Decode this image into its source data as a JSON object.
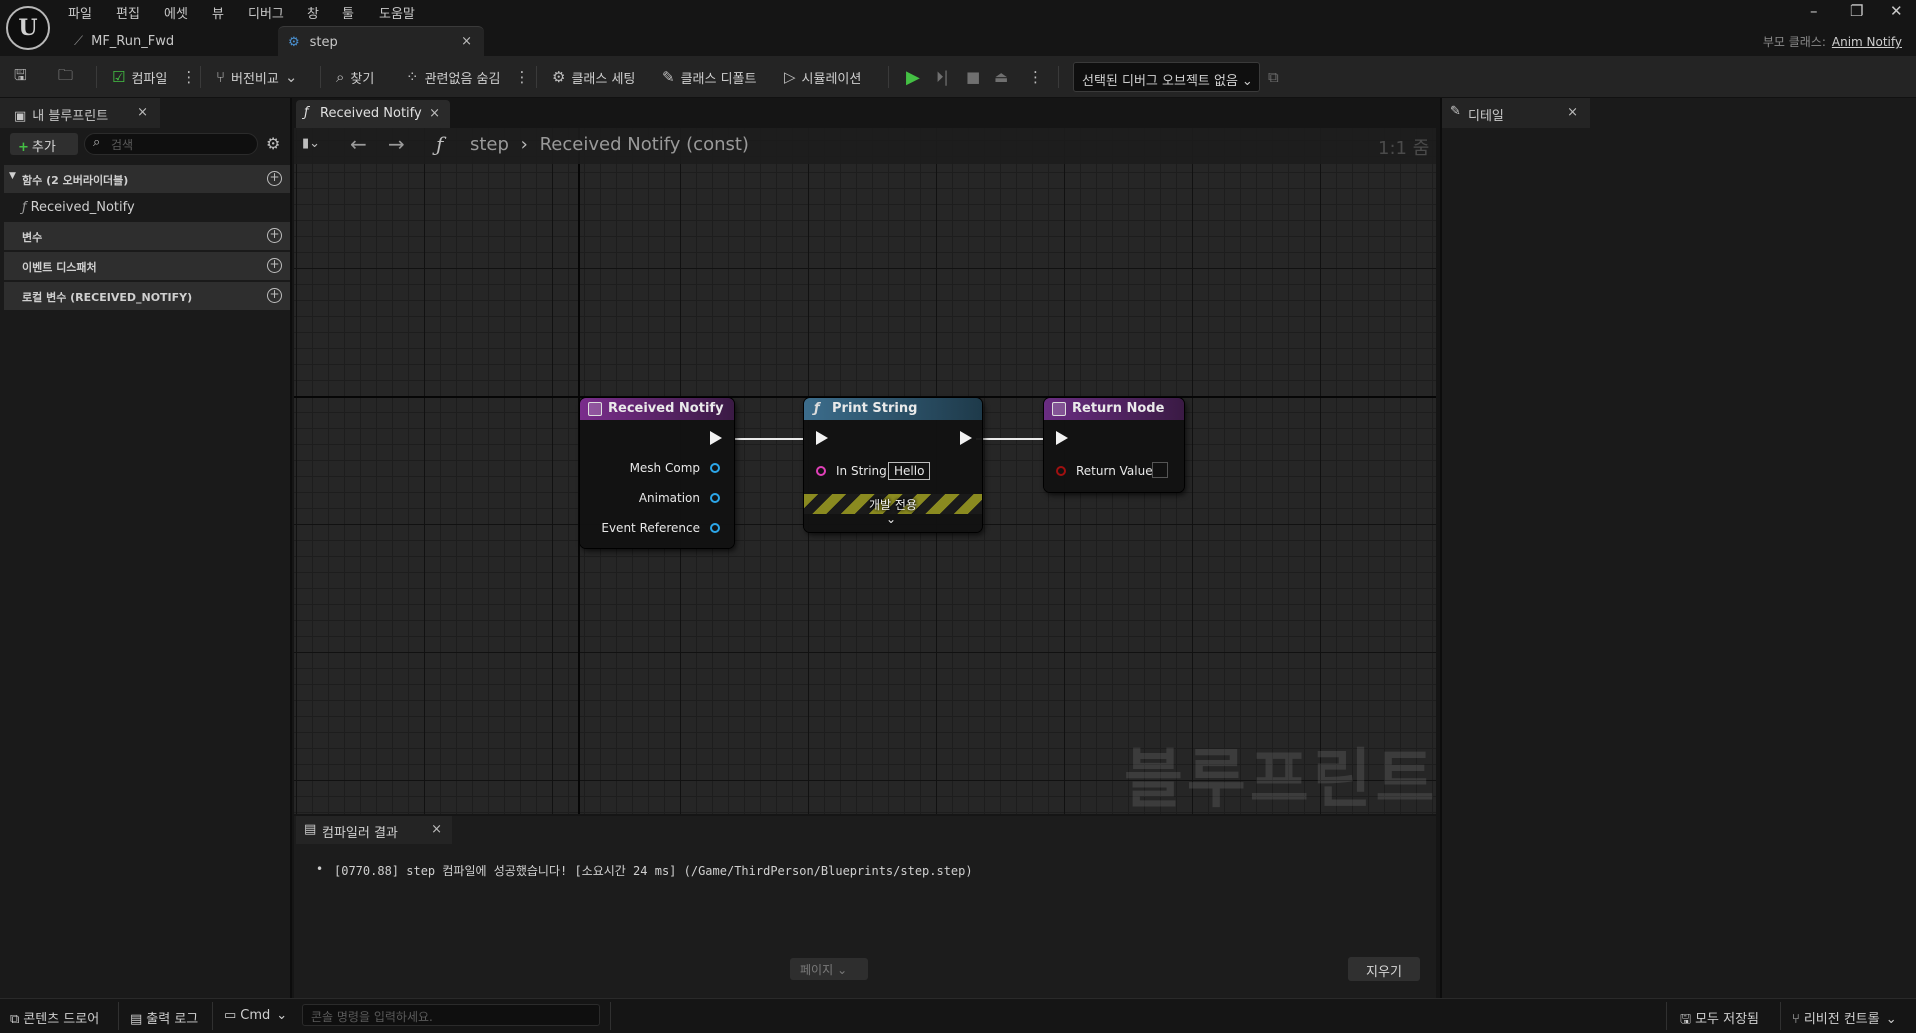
{
  "menu": [
    "파일",
    "편집",
    "에셋",
    "뷰",
    "디버그",
    "창",
    "툴",
    "도움말"
  ],
  "tabs": {
    "asset": "MF_Run_Fwd",
    "step": "step"
  },
  "window": {
    "minimize": "–",
    "restore": "❐",
    "close": "✕"
  },
  "parent_class": {
    "label": "부모 클래스:",
    "value": "Anim Notify"
  },
  "toolbar": {
    "compile": "컴파일",
    "diff": "버전비교",
    "find": "찾기",
    "hide_unrelated": "관련없음 숨김",
    "class_settings": "클래스 세팅",
    "class_defaults": "클래스 디폴트",
    "simulation": "시뮬레이션",
    "debug_object": "선택된 디버그 오브젝트 없음"
  },
  "my_blueprint": {
    "tab": "내 블루프린트",
    "add": "추가",
    "search_placeholder": "검색",
    "sections": [
      {
        "label": "함수 (2 오버라이더블)"
      },
      {
        "label": "변수"
      },
      {
        "label": "이벤트 디스패처"
      },
      {
        "label": "로컬 변수 (RECEIVED_NOTIFY)"
      }
    ],
    "function_item": "Received_Notify"
  },
  "graph": {
    "tab": "Received Notify",
    "breadcrumb_root": "step",
    "breadcrumb_current": "Received Notify (const)",
    "zoom": "1:1 줌",
    "watermark": "블루프린트"
  },
  "nodes": {
    "received_notify": {
      "title": "Received Notify",
      "pins": [
        "Mesh Comp",
        "Animation",
        "Event Reference"
      ]
    },
    "print_string": {
      "title": "Print String",
      "in_string_label": "In String",
      "in_string_value": "Hello",
      "dev_only": "개발 전용"
    },
    "return_node": {
      "title": "Return Node",
      "return_value": "Return Value"
    }
  },
  "compiler": {
    "tab": "컴파일러 결과",
    "message": "[0770.88] step 컴파일에 성공했습니다! [소요시간 24 ms] (/Game/ThirdPerson/Blueprints/step.step)",
    "page": "페이지",
    "clear": "지우기"
  },
  "details": {
    "tab": "디테일"
  },
  "statusbar": {
    "content_drawer": "콘텐츠 드로어",
    "output_log": "출력 로그",
    "cmd": "Cmd",
    "console_placeholder": "콘솔 명령을 입력하세요.",
    "save_all": "모두 저장됨",
    "revision_control": "리비전 컨트롤"
  },
  "colors": {
    "event_header": "#7a2d8c",
    "function_header": "#3c6d8c",
    "return_header": "#6a2d82",
    "exec_wire": "#eaeaea",
    "object_pin": "#2ca6e8",
    "string_pin": "#e040b8",
    "bool_pin": "#a01010",
    "compile_green": "#44c044"
  }
}
